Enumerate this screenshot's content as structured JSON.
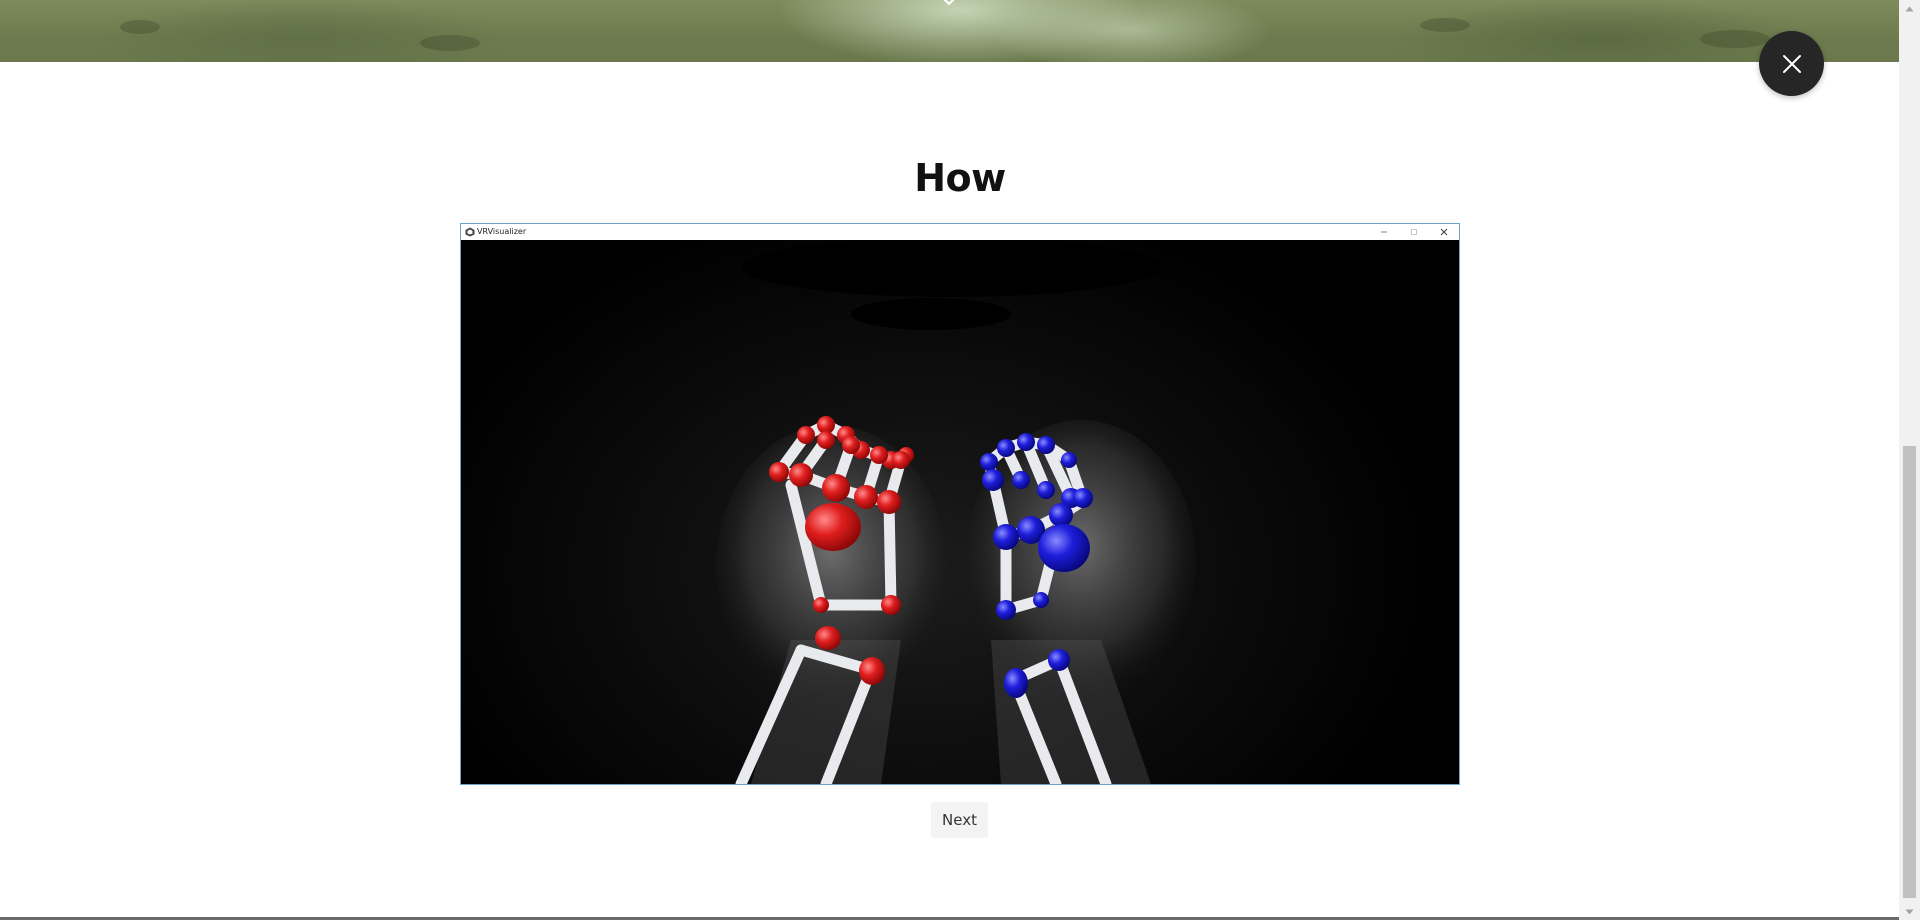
{
  "section": {
    "title": "How"
  },
  "app_window": {
    "title": "VRVisualizer",
    "icon": "unity-icon",
    "controls": [
      "minimize-icon",
      "maximize-icon",
      "close-icon"
    ]
  },
  "navigation": {
    "next_label": "Next"
  },
  "overlay": {
    "close_icon": "close-icon"
  },
  "colors": {
    "left_hand_joints": "#e01e1e",
    "right_hand_joints": "#1e1edc",
    "bones": "#e6e8ec",
    "close_button_bg": "#262626"
  }
}
